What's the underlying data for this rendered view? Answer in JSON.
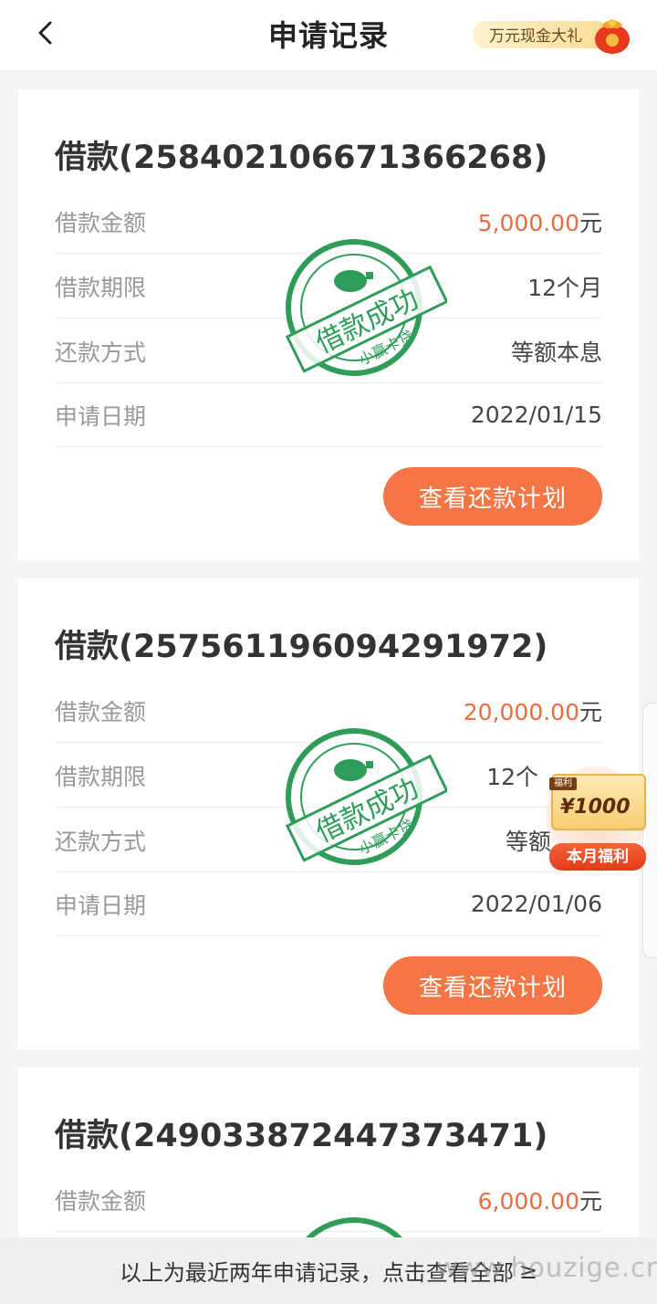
{
  "header": {
    "title": "申请记录",
    "promo_label": "万元现金大礼"
  },
  "records": [
    {
      "title": "借款(2584021066713662​68)",
      "amount_label": "借款金额",
      "amount": "5,000.00",
      "amount_unit": "元",
      "term_label": "借款期限",
      "term": "12个月",
      "method_label": "还款方式",
      "method": "等额本息",
      "date_label": "申请日期",
      "date": "2022/01/15",
      "plan_button": "查看还款计划",
      "stamp_text": "借款成功",
      "stamp_brand": "小赢卡贷"
    },
    {
      "title": "借款(257561196094291972)",
      "amount_label": "借款金额",
      "amount": "20,000.00",
      "amount_unit": "元",
      "term_label": "借款期限",
      "term": "12个",
      "method_label": "还款方式",
      "method": "等额",
      "date_label": "申请日期",
      "date": "2022/01/06",
      "plan_button": "查看还款计划",
      "stamp_text": "借款成功",
      "stamp_brand": "小赢卡贷"
    },
    {
      "title": "借款(249033872447373471)",
      "amount_label": "借款金额",
      "amount": "6,000.00",
      "amount_unit": "元"
    }
  ],
  "welfare": {
    "tag": "福利",
    "amount": "¥1000",
    "label": "本月福利"
  },
  "footer": {
    "text": "以上为最近两年申请记录，点击查看全部",
    "chevron": "≥"
  },
  "watermark": "www.houzige.cn",
  "colors": {
    "accent": "#f57644",
    "amount": "#ee6b3c",
    "stamp": "#2f9c5a"
  }
}
